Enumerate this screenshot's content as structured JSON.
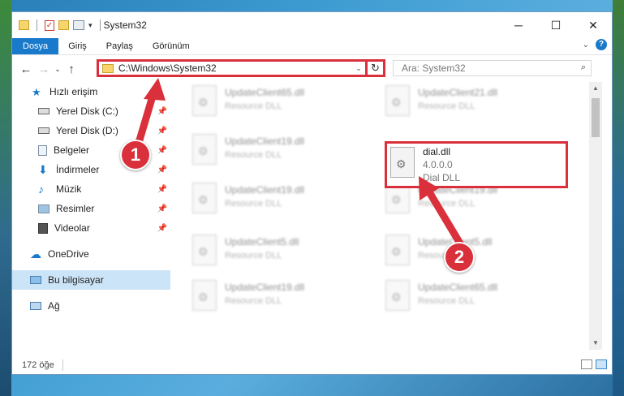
{
  "window": {
    "title": "System32",
    "minimize_label": "─",
    "maximize_label": "☐",
    "close_label": "✕"
  },
  "ribbon": {
    "tabs": [
      "Dosya",
      "Giriş",
      "Paylaş",
      "Görünüm"
    ],
    "help_label": "?"
  },
  "address": {
    "path": "C:\\Windows\\System32",
    "search_placeholder": "Ara: System32"
  },
  "sidebar": {
    "quick_access": "Hızlı erişim",
    "items": [
      {
        "label": "Yerel Disk (C:)",
        "icon": "drive-icon"
      },
      {
        "label": "Yerel Disk (D:)",
        "icon": "drive-icon"
      },
      {
        "label": "Belgeler",
        "icon": "documents-icon"
      },
      {
        "label": "İndirmeler",
        "icon": "download-icon"
      },
      {
        "label": "Müzik",
        "icon": "music-icon"
      },
      {
        "label": "Resimler",
        "icon": "pictures-icon"
      },
      {
        "label": "Videolar",
        "icon": "video-icon"
      }
    ],
    "onedrive": "OneDrive",
    "this_pc": "Bu bilgisayar",
    "network": "Ağ"
  },
  "files": [
    {
      "name": "UpdateClient65.dll",
      "desc": "Resource DLL"
    },
    {
      "name": "UpdateClient21.dll",
      "desc": "Resource DLL"
    },
    {
      "name": "UpdateClient19.dll",
      "desc": "Resource DLL"
    },
    {
      "name": "dial.dll",
      "version": "4.0.0.0",
      "desc": "Dial DLL"
    },
    {
      "name": "UpdateClient19.dll",
      "desc": "Resource DLL"
    },
    {
      "name": "UpdateClient19.dll",
      "desc": "Resource DLL"
    },
    {
      "name": "UpdateClient5.dll",
      "desc": "Resource DLL"
    },
    {
      "name": "UpdateClient5.dll",
      "desc": "Resource DLL"
    },
    {
      "name": "UpdateClient19.dll",
      "desc": "Resource DLL"
    },
    {
      "name": "UpdateClient65.dll",
      "desc": "Resource DLL"
    }
  ],
  "status": {
    "item_count": "172 öğe"
  },
  "annotations": {
    "step1": "1",
    "step2": "2",
    "color": "#d9303b"
  },
  "colors": {
    "accent": "#1979ca",
    "highlight": "#d9303b",
    "selection": "#cce4f7"
  }
}
